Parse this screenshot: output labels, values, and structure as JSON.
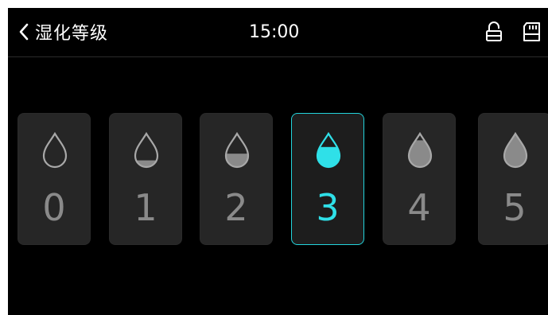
{
  "header": {
    "back_icon": "chevron-left-icon",
    "title": "湿化等级",
    "time": "15:00",
    "lock_icon": "lock-icon",
    "sd_card_icon": "sd-card-icon"
  },
  "humidity_levels": {
    "selected": "3",
    "items": [
      {
        "label": "0",
        "fill": 0,
        "icon": "water-drop-icon"
      },
      {
        "label": "1",
        "fill": 0.2,
        "icon": "water-drop-icon"
      },
      {
        "label": "2",
        "fill": 0.4,
        "icon": "water-drop-icon"
      },
      {
        "label": "3",
        "fill": 0.6,
        "icon": "water-drop-icon"
      },
      {
        "label": "4",
        "fill": 0.8,
        "icon": "water-drop-icon"
      },
      {
        "label": "5",
        "fill": 1.0,
        "icon": "water-drop-icon"
      }
    ]
  },
  "colors": {
    "accent": "#2fe0e8",
    "inactive": "#8a8a8a",
    "background": "#000000"
  }
}
